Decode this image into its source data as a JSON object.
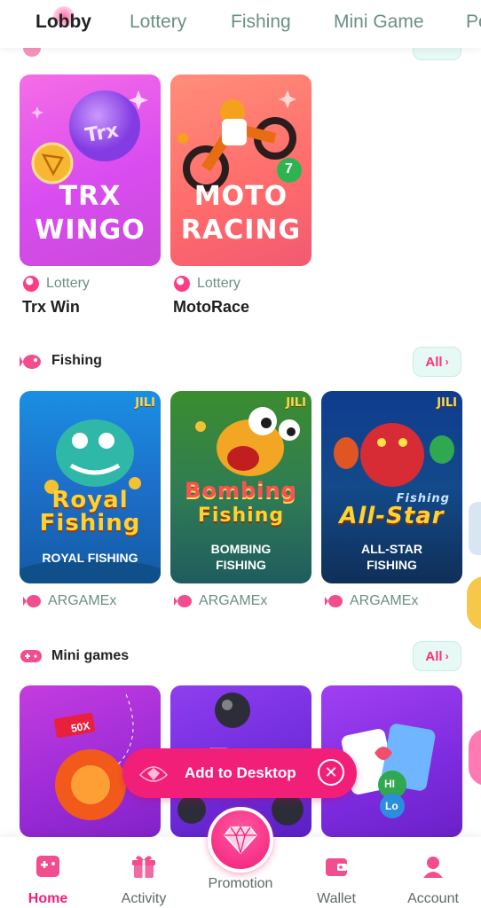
{
  "top_tabs": [
    "Lobby",
    "Lottery",
    "Fishing",
    "Mini Game",
    "Po"
  ],
  "lottery_cards": [
    {
      "art_line1": "TRX",
      "art_line2": "WINGO",
      "badge": "Trx",
      "category": "Lottery",
      "name": "Trx Win"
    },
    {
      "art_line1": "MOTO",
      "art_line2": "RACING",
      "ball_number": "7",
      "category": "Lottery",
      "name": "MotoRace"
    }
  ],
  "fishing_section": {
    "title": "Fishing",
    "all_label": "All",
    "cards": [
      {
        "brand": "JILI",
        "art_line1": "Royal",
        "art_line2": "Fishing",
        "caption": "ROYAL FISHING",
        "provider": "ARGAMEx"
      },
      {
        "brand": "JILI",
        "art_line1": "Bombing",
        "art_line2": "Fishing",
        "caption1": "BOMBING",
        "caption2": "FISHING",
        "provider": "ARGAMEx"
      },
      {
        "brand": "JILI",
        "art_line1": "All-Star",
        "art_small": "Fishing",
        "caption1": "ALL-STAR",
        "caption2": "FISHING",
        "provider": "ARGAMEx"
      }
    ]
  },
  "mini_section": {
    "title": "Mini games",
    "all_label": "All",
    "cards": [
      {
        "tag": "50X"
      },
      {
        "tag": ""
      },
      {
        "hi": "HI",
        "lo": "Lo"
      }
    ]
  },
  "add_to_desktop": {
    "label": "Add to Desktop"
  },
  "bottom_nav": {
    "items": [
      {
        "label": "Home",
        "icon": "gamepad-icon"
      },
      {
        "label": "Activity",
        "icon": "gift-icon"
      },
      {
        "label": "Promotion",
        "icon": "diamond-icon"
      },
      {
        "label": "Wallet",
        "icon": "wallet-icon"
      },
      {
        "label": "Account",
        "icon": "user-icon"
      }
    ]
  },
  "colors": {
    "accent": "#f21f79",
    "muted_green": "#6b8f86",
    "all_btn_bg": "#e7f9f4"
  }
}
